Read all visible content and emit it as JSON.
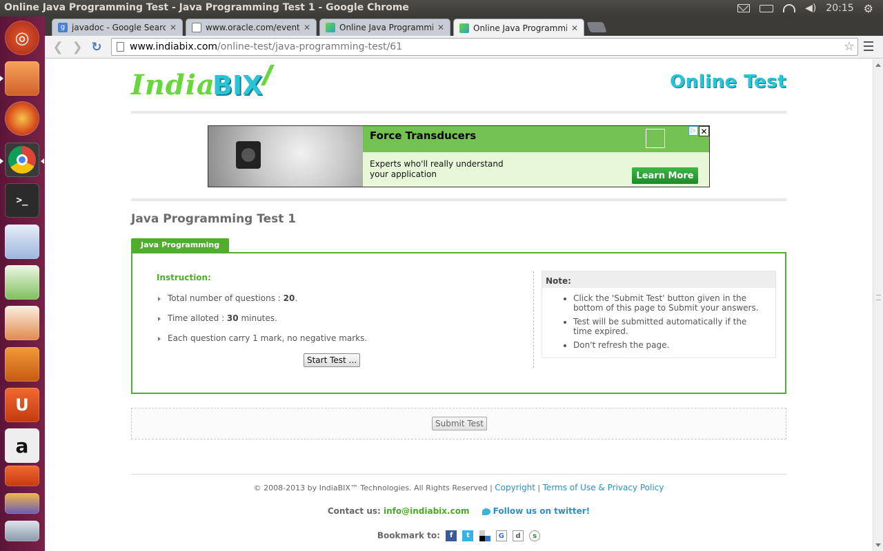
{
  "os": {
    "window_title": "Online Java Programming Test - Java Programming Test 1 - Google Chrome",
    "clock": "20:15",
    "tray_icons": [
      "mail-icon",
      "battery-icon",
      "wifi-icon",
      "volume-icon",
      "gear-icon"
    ],
    "launcher": [
      "ubuntu-dash-icon",
      "files-icon",
      "firefox-icon",
      "chrome-icon",
      "terminal-icon",
      "libreoffice-writer-icon",
      "libreoffice-calc-icon",
      "libreoffice-impress-icon",
      "software-center-icon",
      "ubuntu-one-icon",
      "amazon-icon",
      "ubuntu-one-music-icon",
      "texmaker-icon",
      "document-viewer-icon"
    ]
  },
  "browser": {
    "tabs": [
      {
        "title": "javadoc - Google Search",
        "favicon": "google-icon"
      },
      {
        "title": "www.oracle.com/events/",
        "favicon": "page-icon"
      },
      {
        "title": "Online Java Programming",
        "favicon": "indiabix-icon"
      },
      {
        "title": "Online Java Programming",
        "favicon": "indiabix-icon",
        "active": true
      }
    ],
    "url_host": "www.indiabix.com",
    "url_path": "/online-test/java-programming-test/61"
  },
  "page": {
    "header_right": "Online Test",
    "logo_text_1": "India",
    "logo_text_2": "BIX",
    "ad": {
      "headline": "Force Transducers",
      "body": "Experts who'll really understand your application",
      "cta": "Learn More",
      "choice": "▷",
      "close": "✕"
    },
    "test_title": "Java Programming Test 1",
    "category_tab": "Java Programming",
    "instruction_label": "Instruction:",
    "bullets": [
      {
        "pre": "Total number of questions : ",
        "bold": "20",
        "post": "."
      },
      {
        "pre": "Time alloted : ",
        "bold": "30",
        "post": " minutes."
      },
      {
        "pre": "Each question carry 1 mark, no negative marks.",
        "bold": "",
        "post": ""
      }
    ],
    "start_button": "Start Test ...",
    "note": {
      "title": "Note:",
      "items": [
        "Click the 'Submit Test' button given in the bottom of this page to Submit your answers.",
        "Test will be submitted automatically if the time expired.",
        "Don't refresh the page."
      ]
    },
    "submit_button": "Submit Test",
    "footer": {
      "copyright": "© 2008-2013 by IndiaBIX™ Technologies. All Rights Reserved |",
      "copyright_link": "Copyright",
      "sep": "|",
      "terms_link": "Terms of Use & Privacy Policy",
      "contact_label": "Contact us:",
      "email": "info@indiabix.com",
      "twitter": "Follow us on twitter!",
      "bookmark_label": "Bookmark to:"
    }
  },
  "colors": {
    "accent_green": "#51ad2e",
    "link_blue": "#2b8fc7",
    "logo_cyan": "#29c4d8"
  }
}
